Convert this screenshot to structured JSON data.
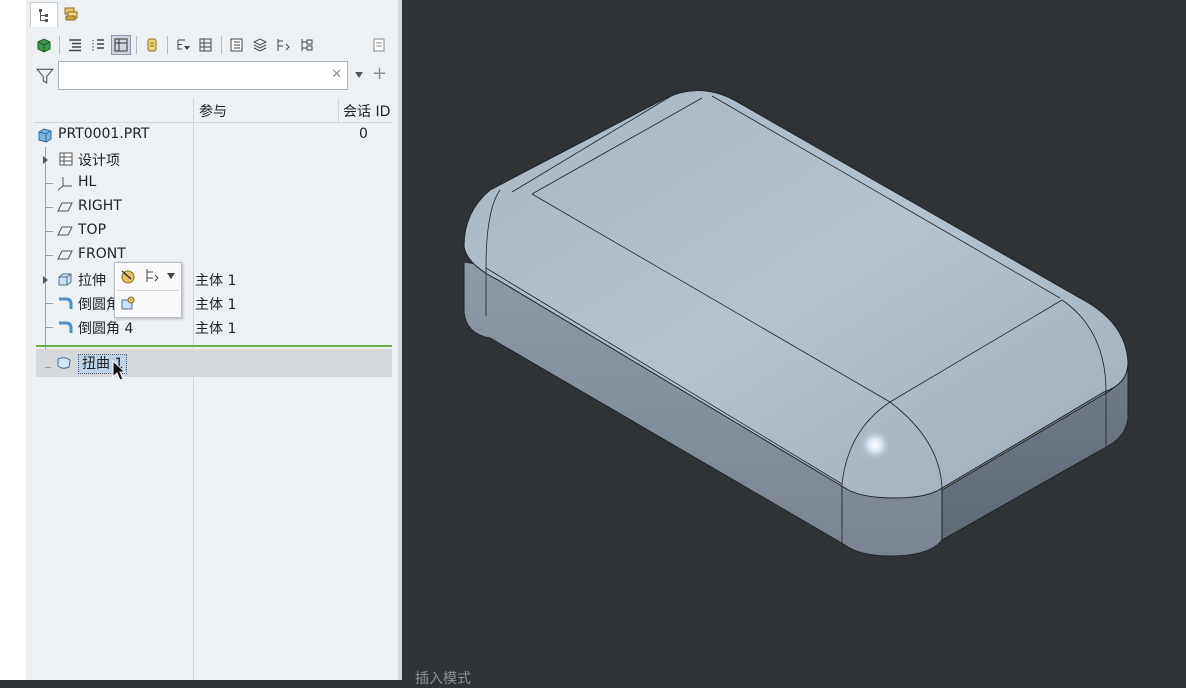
{
  "tabs": [
    {
      "name": "model-tree-tab",
      "icon": "model-tree-icon",
      "active": true
    },
    {
      "name": "layer-tree-tab",
      "icon": "layer-tree-icon",
      "active": false
    }
  ],
  "search": {
    "value": "",
    "placeholder": ""
  },
  "columns": [
    "参与",
    "会话 ID"
  ],
  "tree": {
    "root": {
      "label": "PRT0001.PRT",
      "session_id": "0"
    },
    "items": [
      {
        "label": "设计项",
        "icon": "design-items-icon",
        "participation": ""
      },
      {
        "label": "HL",
        "icon": "coordinate-system-icon",
        "participation": ""
      },
      {
        "label": "RIGHT",
        "icon": "datum-plane-icon",
        "participation": ""
      },
      {
        "label": "TOP",
        "icon": "datum-plane-icon",
        "participation": ""
      },
      {
        "label": "FRONT",
        "icon": "datum-plane-icon",
        "participation": ""
      },
      {
        "label": "拉伸",
        "icon": "extrude-icon",
        "participation": "主体 1"
      },
      {
        "label": "倒圆角",
        "icon": "round-icon",
        "participation": "主体 1"
      },
      {
        "label": "倒圆角 4",
        "icon": "round-icon",
        "participation": "主体 1"
      }
    ],
    "selected": {
      "label": "扭曲 1",
      "icon": "warp-icon"
    }
  },
  "status": {
    "text": "插入模式"
  },
  "colors": {
    "viewport_bg": "#2f3336",
    "panel_bg": "#eef1f4",
    "model": "#a3b1c0",
    "insert_marker": "#6ab04c"
  }
}
